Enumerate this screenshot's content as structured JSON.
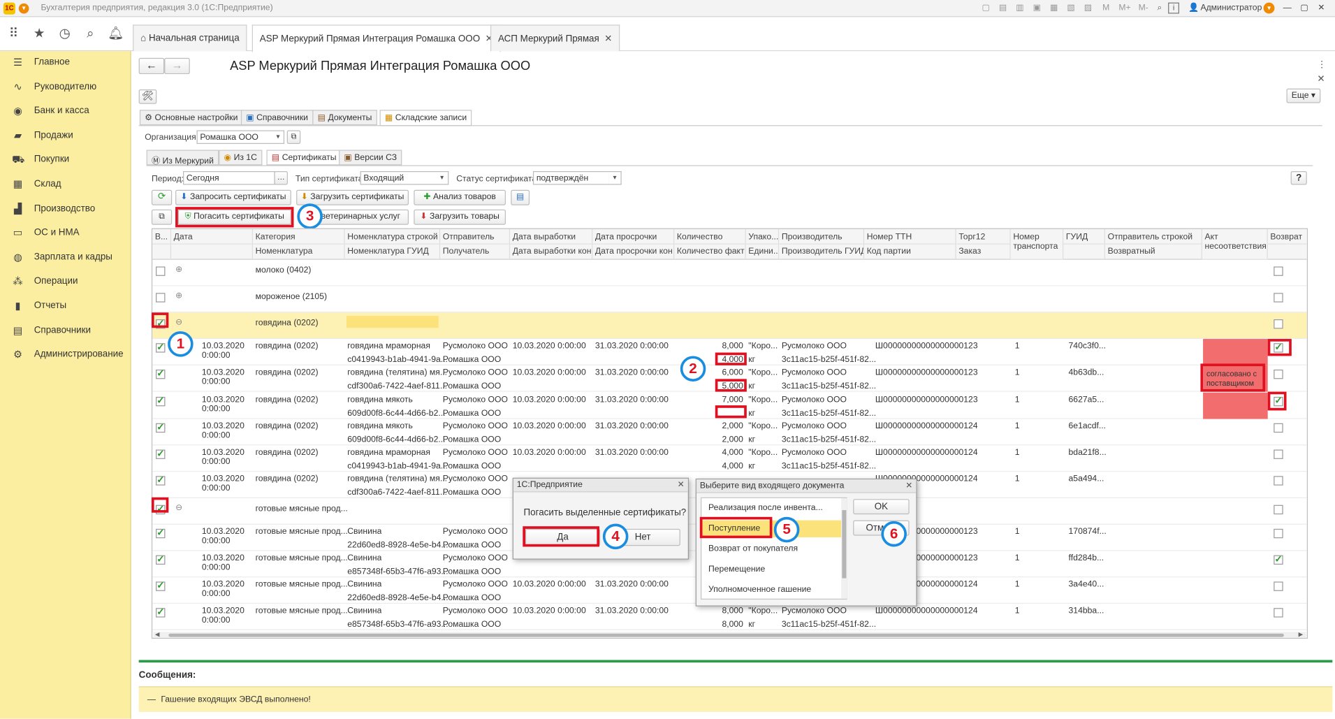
{
  "titlebar": {
    "title": "Бухгалтерия предприятия, редакция 3.0  (1С:Предприятие)",
    "user": "Администратор"
  },
  "tabs": [
    {
      "label": "Начальная страница",
      "closable": false
    },
    {
      "label": "ASP Меркурий Прямая Интеграция Ромашка ООО",
      "closable": true
    },
    {
      "label": "АСП Меркурий Прямая",
      "closable": true
    }
  ],
  "sidebar": {
    "items": [
      {
        "label": "Главное",
        "icon": "menu-icon"
      },
      {
        "label": "Руководителю",
        "icon": "chart-icon"
      },
      {
        "label": "Банк и касса",
        "icon": "coin-icon"
      },
      {
        "label": "Продажи",
        "icon": "bag-icon"
      },
      {
        "label": "Покупки",
        "icon": "cart-icon"
      },
      {
        "label": "Склад",
        "icon": "grid-icon"
      },
      {
        "label": "Производство",
        "icon": "factory-icon"
      },
      {
        "label": "ОС и НМА",
        "icon": "truck-icon"
      },
      {
        "label": "Зарплата и кадры",
        "icon": "person-icon"
      },
      {
        "label": "Операции",
        "icon": "operations-icon"
      },
      {
        "label": "Отчеты",
        "icon": "bars-icon"
      },
      {
        "label": "Справочники",
        "icon": "book-icon"
      },
      {
        "label": "Администрирование",
        "icon": "gear-icon"
      }
    ]
  },
  "form": {
    "title": "ASP Меркурий Прямая Интеграция Ромашка ООО",
    "more_label": "Еще",
    "main_tabs": [
      "Основные настройки",
      "Справочники",
      "Документы",
      "Складские записи"
    ],
    "org_label": "Организация:",
    "org_value": "Ромашка ООО",
    "sub_tabs": [
      "Из Меркурий",
      "Из 1С",
      "Сертификаты",
      "Версии СЗ"
    ],
    "period_label": "Период:",
    "period_value": "Сегодня",
    "cert_type_label": "Тип сертификата:",
    "cert_type_value": "Входящий",
    "cert_status_label": "Статус сертификата:",
    "cert_status_value": "подтверждён",
    "help_label": "?",
    "btn_request": "Запросить сертификаты",
    "btn_load": "Загрузить сертификаты",
    "btn_analyze": "Анализ товаров",
    "btn_redeem": "Погасить сертификаты",
    "btn_vet": "т ветеринарных услуг",
    "btn_load_goods": "Загрузить товары"
  },
  "grid": {
    "headers_top": [
      "В...",
      "Дата",
      "Категория",
      "Номенклатура строкой",
      "Отправитель",
      "Дата выработки",
      "Дата просрочки",
      "Количество",
      "Упако...",
      "Производитель",
      "Номер ТТН",
      "Торг12",
      "Номер транспорта",
      "ГУИД",
      "Отправитель строкой",
      "Акт несоответствия",
      "Возврат"
    ],
    "headers_bottom": [
      "",
      "",
      "Номенклатура",
      "Номенклатура ГУИД",
      "Получатель",
      "Дата выработки кон",
      "Дата просрочки кон",
      "Количество факт",
      "Едини...",
      "Производитель ГУИД",
      "Код партии",
      "Заказ",
      "",
      "",
      "Возвратный",
      "",
      ""
    ],
    "groups": [
      {
        "name": "молоко (0402)"
      },
      {
        "name": "мороженое (2105)"
      },
      {
        "name": "говядина (0202)"
      },
      {
        "name": "готовые мясные прод..."
      }
    ],
    "rows": [
      {
        "date": "10.03.2020",
        "time": "0:00:00",
        "cat": "говядина (0202)",
        "nom1": "говядина мраморная",
        "nom2": "c0419943-b1ab-4941-9a...",
        "snd": "Русмолоко ООО",
        "rcv": "Ромашка ООО",
        "d1": "10.03.2020 0:00:00",
        "d2": "31.03.2020 0:00:00",
        "q1": "8,000",
        "q2": "4,000",
        "pk": "\"Коро...",
        "unit": "кг",
        "mfr": "Русмолоко ООО",
        "mfr2": "3c11ac15-b25f-451f-82...",
        "ttn": "Ш00000000000000000123",
        "tr": "1",
        "guid": "740c3f0...",
        "act": "",
        "ret": true
      },
      {
        "date": "10.03.2020",
        "time": "0:00:00",
        "cat": "говядина (0202)",
        "nom1": "говядина (телятина) мя...",
        "nom2": "cdf300a6-7422-4aef-811...",
        "snd": "Русмолоко ООО",
        "rcv": "Ромашка ООО",
        "d1": "10.03.2020 0:00:00",
        "d2": "31.03.2020 0:00:00",
        "q1": "6,000",
        "q2": "5,000",
        "pk": "\"Коро...",
        "unit": "кг",
        "mfr": "Русмолоко ООО",
        "mfr2": "3c11ac15-b25f-451f-82...",
        "ttn": "Ш00000000000000000123",
        "tr": "1",
        "guid": "4b63db...",
        "act": "согласовано с поставщиком",
        "ret": false
      },
      {
        "date": "10.03.2020",
        "time": "0:00:00",
        "cat": "говядина (0202)",
        "nom1": "говядина мякоть",
        "nom2": "609d00f8-6c44-4d66-b2...",
        "snd": "Русмолоко ООО",
        "rcv": "Ромашка ООО",
        "d1": "10.03.2020 0:00:00",
        "d2": "31.03.2020 0:00:00",
        "q1": "7,000",
        "q2": "",
        "pk": "\"Коро...",
        "unit": "кг",
        "mfr": "Русмолоко ООО",
        "mfr2": "3c11ac15-b25f-451f-82...",
        "ttn": "Ш00000000000000000123",
        "tr": "1",
        "guid": "6627a5...",
        "act": "",
        "ret": true
      },
      {
        "date": "10.03.2020",
        "time": "0:00:00",
        "cat": "говядина (0202)",
        "nom1": "говядина мякоть",
        "nom2": "609d00f8-6c44-4d66-b2...",
        "snd": "Русмолоко ООО",
        "rcv": "Ромашка ООО",
        "d1": "10.03.2020 0:00:00",
        "d2": "31.03.2020 0:00:00",
        "q1": "2,000",
        "q2": "2,000",
        "pk": "\"Коро...",
        "unit": "кг",
        "mfr": "Русмолоко ООО",
        "mfr2": "3c11ac15-b25f-451f-82...",
        "ttn": "Ш00000000000000000124",
        "tr": "1",
        "guid": "6e1acdf...",
        "act": "",
        "ret": false
      },
      {
        "date": "10.03.2020",
        "time": "0:00:00",
        "cat": "говядина (0202)",
        "nom1": "говядина мраморная",
        "nom2": "c0419943-b1ab-4941-9a...",
        "snd": "Русмолоко ООО",
        "rcv": "Ромашка ООО",
        "d1": "10.03.2020 0:00:00",
        "d2": "31.03.2020 0:00:00",
        "q1": "4,000",
        "q2": "4,000",
        "pk": "\"Коро...",
        "unit": "кг",
        "mfr": "Русмолоко ООО",
        "mfr2": "3c11ac15-b25f-451f-82...",
        "ttn": "Ш00000000000000000124",
        "tr": "1",
        "guid": "bda21f8...",
        "act": "",
        "ret": false
      },
      {
        "date": "10.03.2020",
        "time": "0:00:00",
        "cat": "говядина (0202)",
        "nom1": "говядина (телятина) мя...",
        "nom2": "cdf300a6-7422-4aef-811...",
        "snd": "Русмолоко ООО",
        "rcv": "Ромашка ООО",
        "d1": "",
        "d2": "",
        "q1": "",
        "q2": "",
        "pk": "",
        "unit": "",
        "mfr": "",
        "mfr2": "",
        "ttn": "Ш00000000000000000124",
        "tr": "1",
        "guid": "a5a494...",
        "act": "",
        "ret": false
      },
      {
        "date": "10.03.2020",
        "time": "0:00:00",
        "cat": "готовые мясные прод...",
        "nom1": "Свинина",
        "nom2": "22d60ed8-8928-4e5e-b4...",
        "snd": "Русмолоко ООО",
        "rcv": "Ромашка ООО",
        "d1": "",
        "d2": "",
        "q1": "",
        "q2": "",
        "pk": "",
        "unit": "",
        "mfr": "",
        "mfr2": "",
        "ttn": "Ш00000000000000000123",
        "tr": "1",
        "guid": "170874f...",
        "act": "",
        "ret": false
      },
      {
        "date": "10.03.2020",
        "time": "0:00:00",
        "cat": "готовые мясные прод...",
        "nom1": "Свинина",
        "nom2": "e857348f-65b3-47f6-a93...",
        "snd": "Русмолоко ООО",
        "rcv": "Ромашка ООО",
        "d1": "",
        "d2": "",
        "q1": "",
        "q2": "",
        "pk": "",
        "unit": "",
        "mfr": "",
        "mfr2": "",
        "ttn": "Ш00000000000000000123",
        "tr": "1",
        "guid": "ffd284b...",
        "act": "",
        "ret": true
      },
      {
        "date": "10.03.2020",
        "time": "0:00:00",
        "cat": "готовые мясные прод...",
        "nom1": "Свинина",
        "nom2": "22d60ed8-8928-4e5e-b4...",
        "snd": "Русмолоко ООО",
        "rcv": "Ромашка ООО",
        "d1": "10.03.2020 0:00:00",
        "d2": "31.03.2020 0:00:00",
        "q1": "",
        "q2": "",
        "pk": "",
        "unit": "",
        "mfr": "",
        "mfr2": "",
        "ttn": "Ш00000000000000000124",
        "tr": "1",
        "guid": "3a4e40...",
        "act": "",
        "ret": false
      },
      {
        "date": "10.03.2020",
        "time": "0:00:00",
        "cat": "готовые мясные прод...",
        "nom1": "Свинина",
        "nom2": "e857348f-65b3-47f6-a93...",
        "snd": "Русмолоко ООО",
        "rcv": "Ромашка ООО",
        "d1": "10.03.2020 0:00:00",
        "d2": "31.03.2020 0:00:00",
        "q1": "8,000",
        "q2": "8,000",
        "pk": "\"Коро...",
        "unit": "кг",
        "mfr": "Русмолоко ООО",
        "mfr2": "3c11ac15-b25f-451f-82...",
        "ttn": "Ш00000000000000000124",
        "tr": "1",
        "guid": "314bba...",
        "act": "",
        "ret": false
      }
    ]
  },
  "dialog_confirm": {
    "title": "1С:Предприятие",
    "question": "Погасить выделенные сертификаты?",
    "yes": "Да",
    "no": "Нет"
  },
  "dialog_doc": {
    "title": "Выберите вид входящего документа",
    "items": [
      "Реализация после инвента...",
      "Поступление",
      "Возврат от покупателя",
      "Перемещение",
      "Уполномоченное гашение"
    ],
    "ok": "OK",
    "cancel": "Отм"
  },
  "messages": {
    "label": "Сообщения:",
    "text": "Гашение входящих ЭВСД выполнено!"
  },
  "callouts": [
    "1",
    "2",
    "3",
    "4",
    "5",
    "6"
  ],
  "colors": {
    "sidebar": "#fbeea1",
    "highlight": "#fdf1b4",
    "red": "#e01020",
    "callout": "#1a8de0",
    "act": "#f26d6d"
  }
}
